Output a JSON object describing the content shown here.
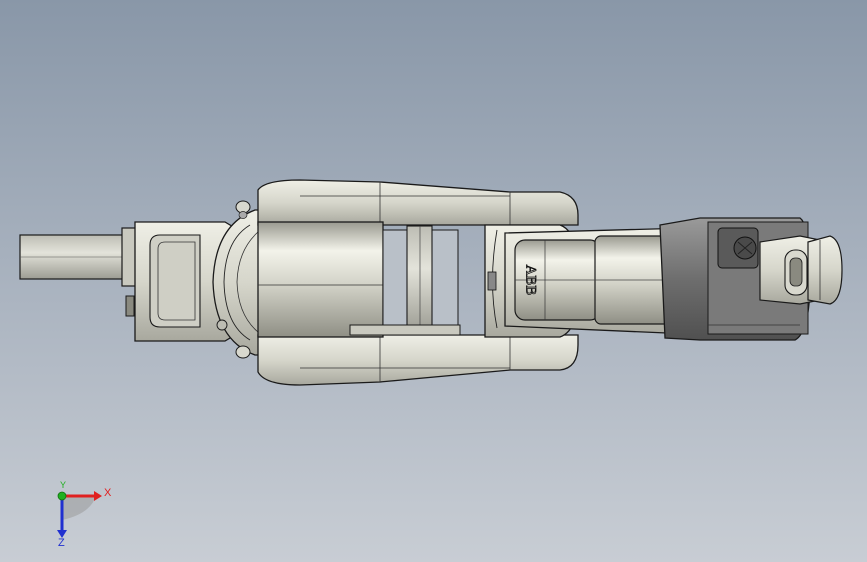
{
  "viewport": {
    "background_top": "#8997a8",
    "background_bottom": "#c8cdd4"
  },
  "model": {
    "name_icon": "industrial-robot-arm",
    "logo_text": "ABB",
    "colors": {
      "body": "#dcdcd2",
      "body_shadow": "#a9a99f",
      "edge": "#1a1a1a",
      "dark_part": "#6f6f6f",
      "dark_part_light": "#8c8c8c"
    }
  },
  "triad": {
    "x_label": "X",
    "y_label": "Y",
    "z_label": "Z",
    "x_color": "#e02020",
    "y_color": "#20b020",
    "z_color": "#2030d0"
  }
}
